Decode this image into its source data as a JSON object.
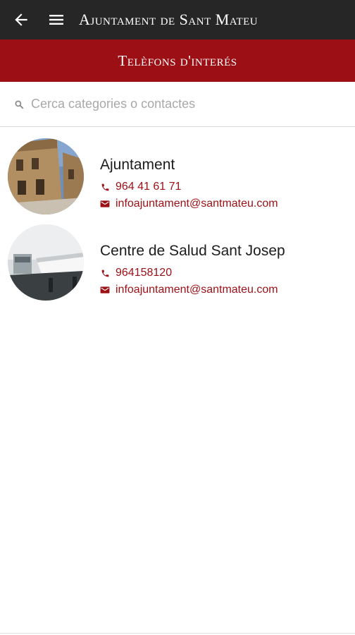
{
  "header": {
    "app_title": "Ajuntament de Sant Mateu",
    "back_icon": "arrow-left-icon",
    "menu_icon": "hamburger-menu-icon"
  },
  "section": {
    "title": "Telèfons d'interés"
  },
  "search": {
    "placeholder": "Cerca categories o contactes",
    "value": "",
    "icon": "search-icon"
  },
  "contacts": [
    {
      "name": "Ajuntament",
      "phone": "964 41 61 71",
      "email": "infoajuntament@santmateu.com",
      "avatar": "town-hall-street-photo"
    },
    {
      "name": "Centre de Salud Sant Josep",
      "phone": "964158120",
      "email": "infoajuntament@santmateu.com",
      "avatar": "clinic-room-photo"
    }
  ],
  "colors": {
    "topbar": "#262626",
    "accent": "#9b0f15",
    "text": "#1c1c1c"
  }
}
